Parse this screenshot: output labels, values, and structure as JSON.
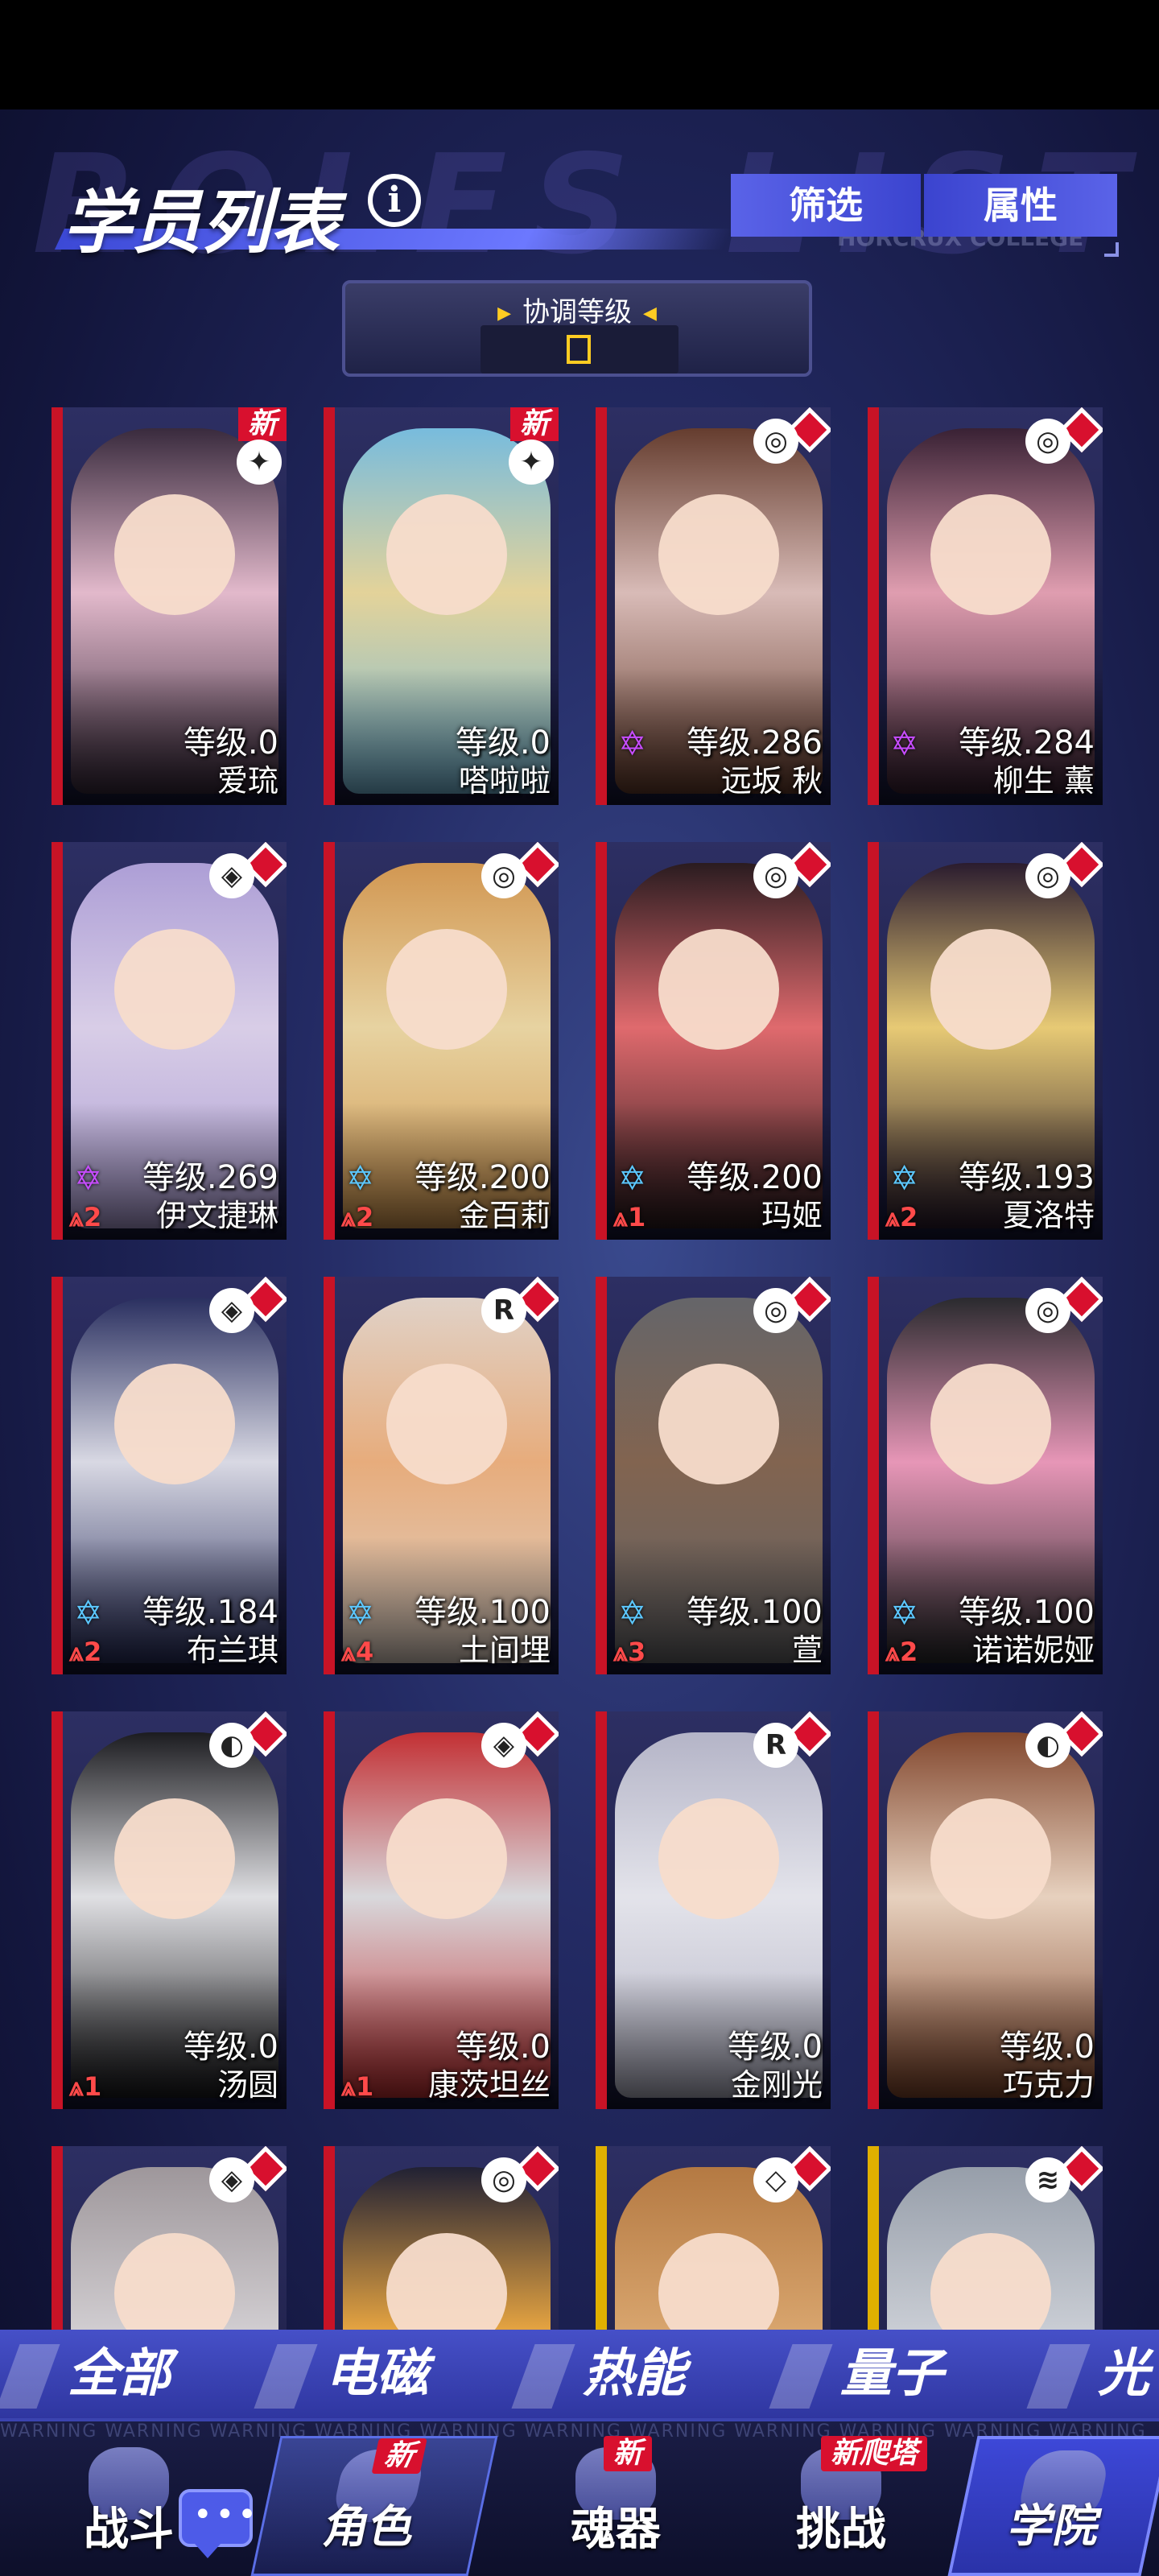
{
  "header": {
    "title": "学员列表",
    "filter_label": "筛选",
    "attribute_label": "属性",
    "college_text": "HORCRUX COLLEGE",
    "background_text": "ROLES LIST"
  },
  "sort": {
    "label": "协调等级"
  },
  "students": [
    {
      "name": "爱琉",
      "level": "等级.0",
      "new": "新",
      "element": "✦"
    },
    {
      "name": "嗒啦啦",
      "level": "等级.0",
      "new": "新",
      "element": "✦"
    },
    {
      "name": "远坂 秋",
      "level": "等级.286",
      "star": "✡",
      "element": "◎"
    },
    {
      "name": "柳生 薰",
      "level": "等级.284",
      "star": "✡",
      "element": "◎"
    },
    {
      "name": "伊文捷琳",
      "level": "等级.269",
      "star": "✡",
      "rank": "⩓2",
      "element": "◈"
    },
    {
      "name": "金百莉",
      "level": "等级.200",
      "star": "✡",
      "rank": "⩓2",
      "element": "◎"
    },
    {
      "name": "玛姬",
      "level": "等级.200",
      "star": "✡",
      "rank": "⩓1",
      "element": "◎"
    },
    {
      "name": "夏洛特",
      "level": "等级.193",
      "star": "✡",
      "rank": "⩓2",
      "element": "◎"
    },
    {
      "name": "布兰琪",
      "level": "等级.184",
      "star": "✡",
      "rank": "⩓2",
      "element": "◈"
    },
    {
      "name": "土间埋",
      "level": "等级.100",
      "star": "✡",
      "rank": "⩓4",
      "element": "R"
    },
    {
      "name": "萱",
      "level": "等级.100",
      "star": "✡",
      "rank": "⩓3",
      "element": "◎"
    },
    {
      "name": "诺诺妮娅",
      "level": "等级.100",
      "star": "✡",
      "rank": "⩓2",
      "element": "◎"
    },
    {
      "name": "汤圆",
      "level": "等级.0",
      "rank": "⩓1",
      "element": "◐"
    },
    {
      "name": "康茨坦丝",
      "level": "等级.0",
      "rank": "⩓1",
      "element": "◈"
    },
    {
      "name": "金刚光",
      "level": "等级.0",
      "element": "R"
    },
    {
      "name": "巧克力",
      "level": "等级.0",
      "element": "◐"
    },
    {
      "name": "",
      "level": "",
      "element": "◈"
    },
    {
      "name": "",
      "level": "",
      "element": "◎"
    },
    {
      "name": "",
      "level": "",
      "element": "◇"
    },
    {
      "name": "",
      "level": "",
      "element": "≋"
    }
  ],
  "element_tabs": [
    "全部",
    "电磁",
    "热能",
    "量子",
    "光"
  ],
  "warning_text": "WARNING   WARNING   WARNING   WARNING   WARNING   WARNING   WARNING   WARNING   WARNING   WARNING   WARNING",
  "chat": {
    "icon": "chat-bubble-icon",
    "text": "•••"
  },
  "nav": {
    "battle": "战斗",
    "role": "角色",
    "role_badge": "新",
    "soul": "魂器",
    "soul_badge": "新",
    "challenge": "挑战",
    "challenge_badge": "新爬塔",
    "academy": "学院"
  },
  "colors": {
    "accent": "#4a55e0",
    "new_badge": "#d8102e",
    "card_stripe": "#c81326"
  }
}
